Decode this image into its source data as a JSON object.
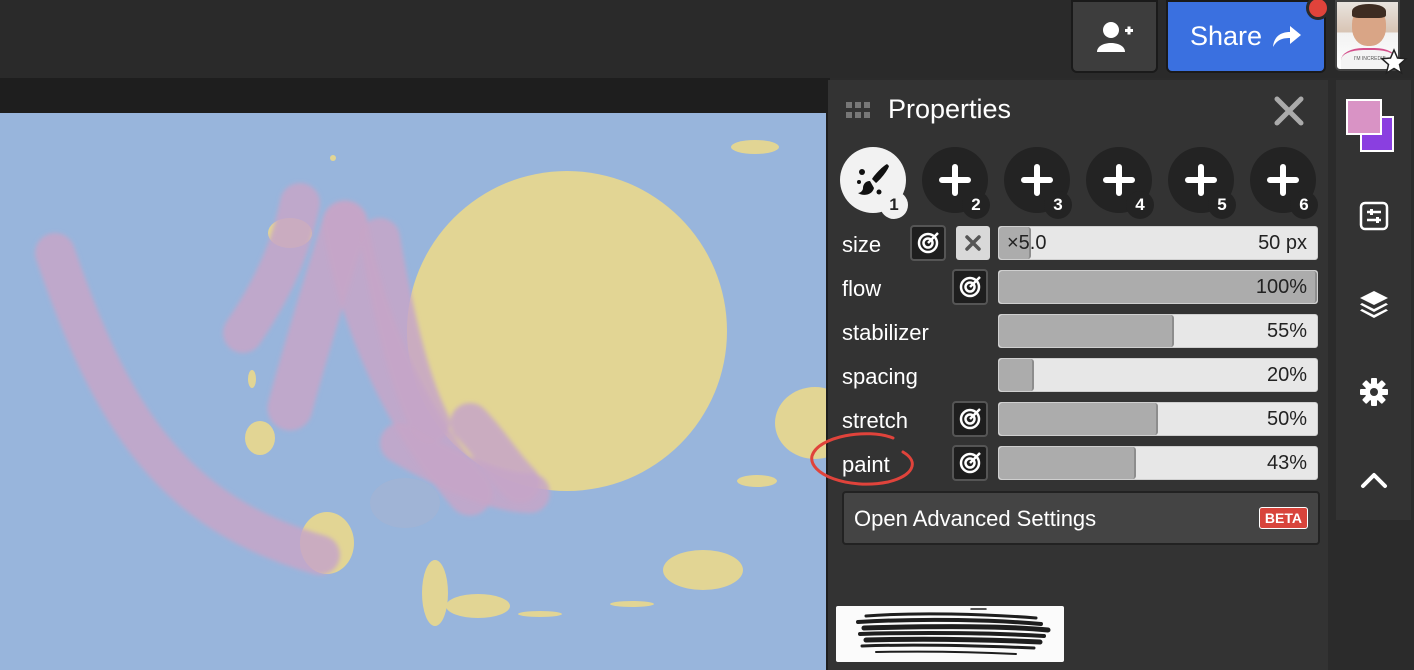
{
  "topbar": {
    "share_label": "Share",
    "invite_icon": "add-user-icon",
    "share_icon": "share-arrow-icon",
    "avatar_badge_icon": "star-icon",
    "avatar_shirt_text": "I'M INCREDIB"
  },
  "panel": {
    "title": "Properties",
    "brush_slots": [
      {
        "number": "1",
        "icon": "brush-icon",
        "active": true
      },
      {
        "number": "2",
        "icon": "plus-icon",
        "active": false
      },
      {
        "number": "3",
        "icon": "plus-icon",
        "active": false
      },
      {
        "number": "4",
        "icon": "plus-icon",
        "active": false
      },
      {
        "number": "5",
        "icon": "plus-icon",
        "active": false
      },
      {
        "number": "6",
        "icon": "plus-icon",
        "active": false
      }
    ],
    "properties": [
      {
        "label": "size",
        "value": "50 px",
        "prefix": "×5.0",
        "fill": 0.1
      },
      {
        "label": "flow",
        "value": "100%",
        "fill": 1.0
      },
      {
        "label": "stabilizer",
        "value": "55%",
        "fill": 0.55
      },
      {
        "label": "spacing",
        "value": "20%",
        "fill": 0.11
      },
      {
        "label": "stretch",
        "value": "50%",
        "fill": 0.5
      },
      {
        "label": "paint",
        "value": "43%",
        "fill": 0.43
      }
    ],
    "advanced_label": "Open Advanced Settings",
    "beta_label": "BETA"
  },
  "colors": {
    "primary": "#d993c5",
    "secondary": "#8a3fe0",
    "canvas_bg": "#98b5dc",
    "sun": "#e2d594",
    "accent": "#3a70e0",
    "annotation": "#e0433b"
  }
}
